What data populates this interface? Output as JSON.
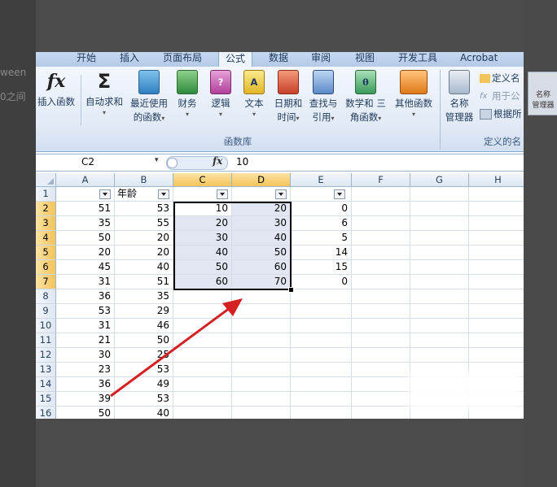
{
  "background": {
    "left_fragment_1": "ween",
    "left_fragment_2": "0之间",
    "right_fragment_1": "名称",
    "right_fragment_2": "管理器"
  },
  "ribbon": {
    "tabs": [
      {
        "label": "开始",
        "active": false
      },
      {
        "label": "插入",
        "active": false
      },
      {
        "label": "页面布局",
        "active": false
      },
      {
        "label": "公式",
        "active": true
      },
      {
        "label": "数据",
        "active": false
      },
      {
        "label": "审阅",
        "active": false
      },
      {
        "label": "视图",
        "active": false
      },
      {
        "label": "开发工具",
        "active": false
      },
      {
        "label": "Acrobat",
        "active": false
      }
    ],
    "insert_function": "插入函数",
    "autosum": "自动求和",
    "recent_l1": "最近使用",
    "recent_l2": "的函数",
    "financial": "财务",
    "logical": "逻辑",
    "text": "文本",
    "datetime_l1": "日期和",
    "datetime_l2": "时间",
    "lookup_l1": "查找与",
    "lookup_l2": "引用",
    "math_l1": "数学和",
    "math_l2": "三角函数",
    "more": "其他函数",
    "group_function_library": "函数库",
    "name_mgr_l1": "名称",
    "name_mgr_l2": "管理器",
    "define_name": "定义名",
    "use_in_formula": "用于公",
    "create_from": "根据所",
    "group_defined_names": "定义的名",
    "dropdown_arrow": "▾",
    "fx_symbol": "fx",
    "sigma_symbol": "Σ"
  },
  "formula_bar": {
    "name_box": "C2",
    "fx_label": "fx",
    "value": "10"
  },
  "sheet": {
    "columns": [
      "A",
      "B",
      "C",
      "D",
      "E",
      "F",
      "G",
      "H"
    ],
    "rows": [
      "1",
      "2",
      "3",
      "4",
      "5",
      "6",
      "7",
      "8",
      "9",
      "10",
      "11",
      "12",
      "13",
      "14",
      "15",
      "16"
    ],
    "header_b1": "年龄",
    "col_a": [
      "51",
      "35",
      "50",
      "20",
      "45",
      "31",
      "36",
      "53",
      "31",
      "21",
      "30",
      "23",
      "36",
      "39",
      "50"
    ],
    "col_b": [
      "53",
      "55",
      "20",
      "20",
      "40",
      "51",
      "35",
      "29",
      "46",
      "50",
      "25",
      "53",
      "49",
      "53",
      "40"
    ],
    "col_c": [
      "10",
      "20",
      "30",
      "40",
      "50",
      "60"
    ],
    "col_d": [
      "20",
      "30",
      "40",
      "50",
      "60",
      "70"
    ],
    "col_e": [
      "0",
      "6",
      "5",
      "14",
      "15",
      "0"
    ]
  },
  "colors": {
    "arrow": "#d42020",
    "selection_fill": "#e1e6f2",
    "header_selected": "#f5c35a",
    "ribbon_bg": "#dfe9f5"
  }
}
